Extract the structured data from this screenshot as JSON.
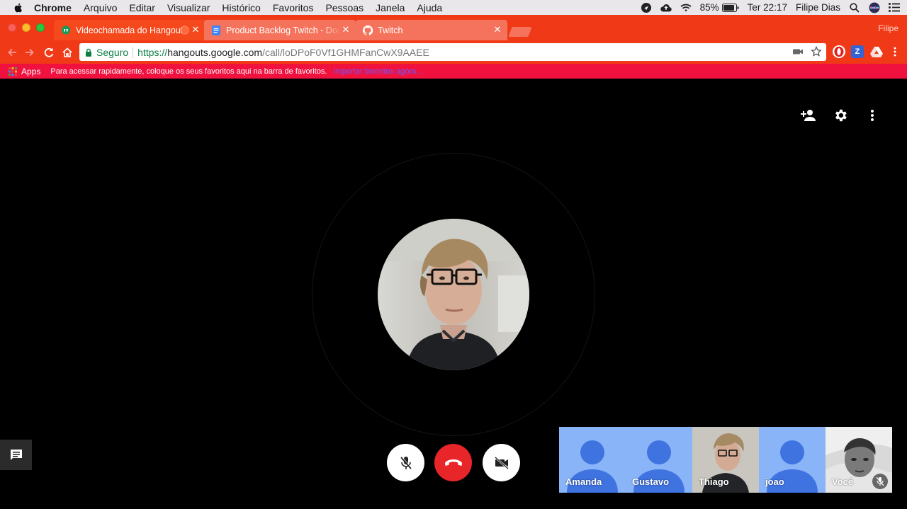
{
  "menubar": {
    "app": "Chrome",
    "items": [
      "Arquivo",
      "Editar",
      "Visualizar",
      "Histórico",
      "Favoritos",
      "Pessoas",
      "Janela",
      "Ajuda"
    ],
    "battery": "85%",
    "clock": "Ter 22:17",
    "user": "Filipe Dias"
  },
  "browser": {
    "profile_name": "Filipe",
    "tabs": [
      {
        "title": "Videochamada do Hangouts",
        "active": true
      },
      {
        "title": "Product Backlog Twitch - Docs",
        "active": false
      },
      {
        "title": "Twitch",
        "active": false
      }
    ],
    "address": {
      "secure_label": "Seguro",
      "scheme": "https://",
      "host": "hangouts.google.com",
      "path": "/call/loDPoF0Vf1GHMFanCwX9AAEE"
    },
    "bookmarks": {
      "apps_label": "Apps",
      "hint": "Para acessar rapidamente, coloque os seus favoritos aqui na barra de favoritos.",
      "import_link": "Importar favoritos agora..."
    },
    "extensions": [
      "Z"
    ]
  },
  "call": {
    "participants": [
      {
        "name": "Amanda",
        "type": "placeholder"
      },
      {
        "name": "Gustavo",
        "type": "placeholder"
      },
      {
        "name": "Thiago",
        "type": "video"
      },
      {
        "name": "joao",
        "type": "placeholder"
      },
      {
        "name": "Você",
        "type": "video",
        "muted": true
      }
    ]
  },
  "colors": {
    "chrome_theme": "#f03a17",
    "bookmarks_bar": "#f0113f",
    "hangup": "#e8262a",
    "placeholder_tile": "#8ab4f8",
    "placeholder_person": "#3f73e0"
  }
}
